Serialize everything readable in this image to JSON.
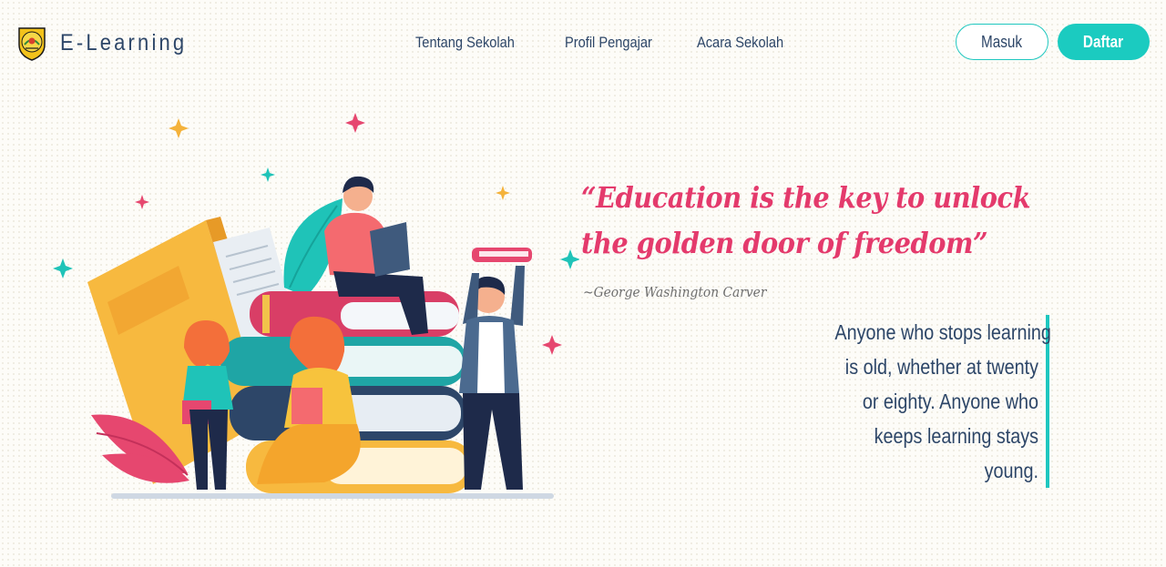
{
  "brand": {
    "name": "E-Learning",
    "logo_icon": "university-seal-icon"
  },
  "nav": {
    "links": [
      "Tentang Sekolah",
      "Profil Pengajar",
      "Acara Sekolah"
    ]
  },
  "auth": {
    "login_label": "Masuk",
    "register_label": "Daftar"
  },
  "hero": {
    "quote_lines": [
      "“Education is the key to unlock",
      "the golden door of freedom”"
    ],
    "author": "~George Washington Carver",
    "side_text_lines": [
      "Anyone who stops learning",
      "is old, whether at twenty",
      "or eighty. Anyone who",
      "keeps learning stays",
      "young."
    ],
    "illustration_icon": "students-reading-books-illustration"
  },
  "colors": {
    "accent": "#1bcbc0",
    "quote": "#e43a6c",
    "text": "#2d4668",
    "author": "#6e6e6e"
  }
}
